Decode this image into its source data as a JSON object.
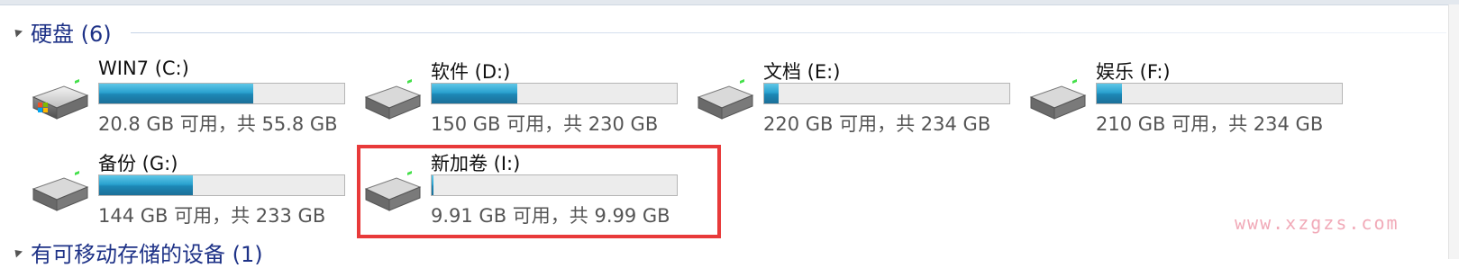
{
  "colors": {
    "accent": "#1e3287",
    "bar_fill": "#2aa2cf",
    "highlight": "#e83a3a",
    "watermark": "#f1aab8"
  },
  "groups": [
    {
      "title": "硬盘 (6)"
    },
    {
      "title": "有可移动存储的设备 (1)"
    }
  ],
  "drives": [
    {
      "name": "WIN7 (C:)",
      "free_text": "20.8 GB 可用，共 55.8 GB",
      "used_fraction": 0.627,
      "icon": "windows-hard-drive-icon"
    },
    {
      "name": "软件 (D:)",
      "free_text": "150 GB 可用，共 230 GB",
      "used_fraction": 0.348,
      "icon": "hard-drive-icon"
    },
    {
      "name": "文档 (E:)",
      "free_text": "220 GB 可用，共 234 GB",
      "used_fraction": 0.06,
      "icon": "hard-drive-icon"
    },
    {
      "name": "娱乐 (F:)",
      "free_text": "210 GB 可用，共 234 GB",
      "used_fraction": 0.103,
      "icon": "hard-drive-icon"
    },
    {
      "name": "备份 (G:)",
      "free_text": "144 GB 可用，共 233 GB",
      "used_fraction": 0.382,
      "icon": "hard-drive-icon"
    },
    {
      "name": "新加卷 (I:)",
      "free_text": "9.91 GB 可用，共 9.99 GB",
      "used_fraction": 0.008,
      "icon": "hard-drive-icon"
    }
  ],
  "watermark": "www.xzgzs.com"
}
